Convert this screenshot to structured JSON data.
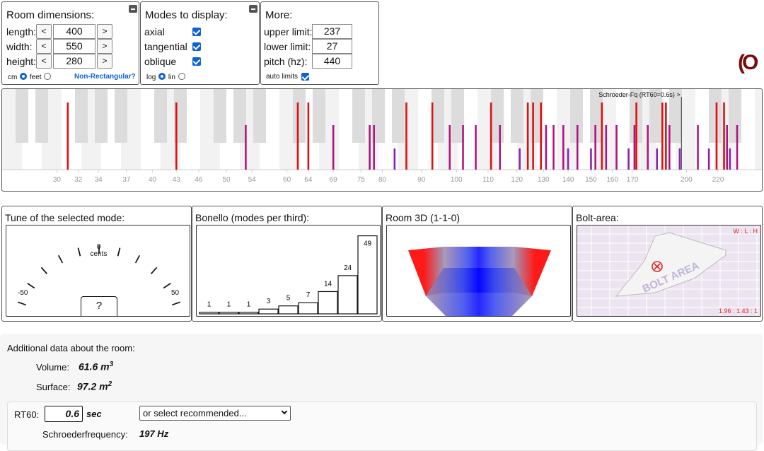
{
  "room": {
    "title": "Room dimensions:",
    "length_label": "length:",
    "width_label": "width:",
    "height_label": "height:",
    "length": "400",
    "width": "550",
    "height": "280",
    "dec": "<",
    "inc": ">",
    "unit_cm": "cm",
    "unit_feet": "feet",
    "non_rect": "Non-Rectangular?"
  },
  "modes": {
    "title": "Modes to display:",
    "axial": "axial",
    "tangential": "tangential",
    "oblique": "oblique",
    "log": "log",
    "lin": "lin"
  },
  "more": {
    "title": "More:",
    "upper_label": "upper limit:",
    "lower_label": "lower limit:",
    "pitch_label": "pitch (hz):",
    "upper": "237",
    "lower": "27",
    "pitch": "440",
    "auto": "auto limits"
  },
  "logo": "(O",
  "spectrum": {
    "schroeder_label": "Schroeder-Fq (RT60=0.6s) >",
    "schroeder_hz": 197,
    "min_hz": 27,
    "max_hz": 237,
    "ticks": [
      30,
      32,
      34,
      37,
      40,
      43,
      46,
      50,
      54,
      60,
      64,
      69,
      75,
      80,
      90,
      100,
      110,
      120,
      130,
      140,
      150,
      160,
      170,
      200,
      220
    ],
    "axial": [
      31,
      43,
      62,
      64,
      86,
      93,
      111,
      124,
      126,
      129,
      155,
      172,
      186,
      188,
      219,
      224
    ],
    "tangential": [
      53,
      69,
      77,
      78,
      98,
      102,
      106,
      114,
      131,
      134,
      138,
      144,
      152,
      157,
      162,
      171,
      178,
      190,
      207,
      226,
      233
    ],
    "oblique": [
      83,
      121,
      140,
      150,
      168,
      183,
      196,
      214,
      228
    ]
  },
  "tune": {
    "title": "Tune of the selected mode:",
    "zero": "0",
    "cents": "cents",
    "minus": "-50",
    "plus": "50",
    "value": "?"
  },
  "bonello": {
    "title": "Bonello (modes per third):",
    "values": [
      1,
      1,
      1,
      3,
      5,
      7,
      14,
      24,
      49
    ]
  },
  "room3d": {
    "title": "Room 3D (1-1-0)"
  },
  "bolt": {
    "title": "Bolt-area:",
    "ratio_label": "W : L : H",
    "ratio": "1.96 : 1.43 : 1",
    "area_text": "BOLT AREA"
  },
  "additional": {
    "title": "Additional data about the room:",
    "volume_label": "Volume:",
    "volume": "61.6 m",
    "volume_sup": "3",
    "surface_label": "Surface:",
    "surface": "97.2 m",
    "surface_sup": "2",
    "rt60_label": "RT60:",
    "rt60": "0.6",
    "rt60_unit": "sec",
    "select": "or select recommended...",
    "schroeder_label": "Schroederfrequency:",
    "schroeder": "197 Hz"
  },
  "colors": {
    "axial": "#e01010",
    "tangential": "#b0157e",
    "oblique": "#8a22b0"
  }
}
